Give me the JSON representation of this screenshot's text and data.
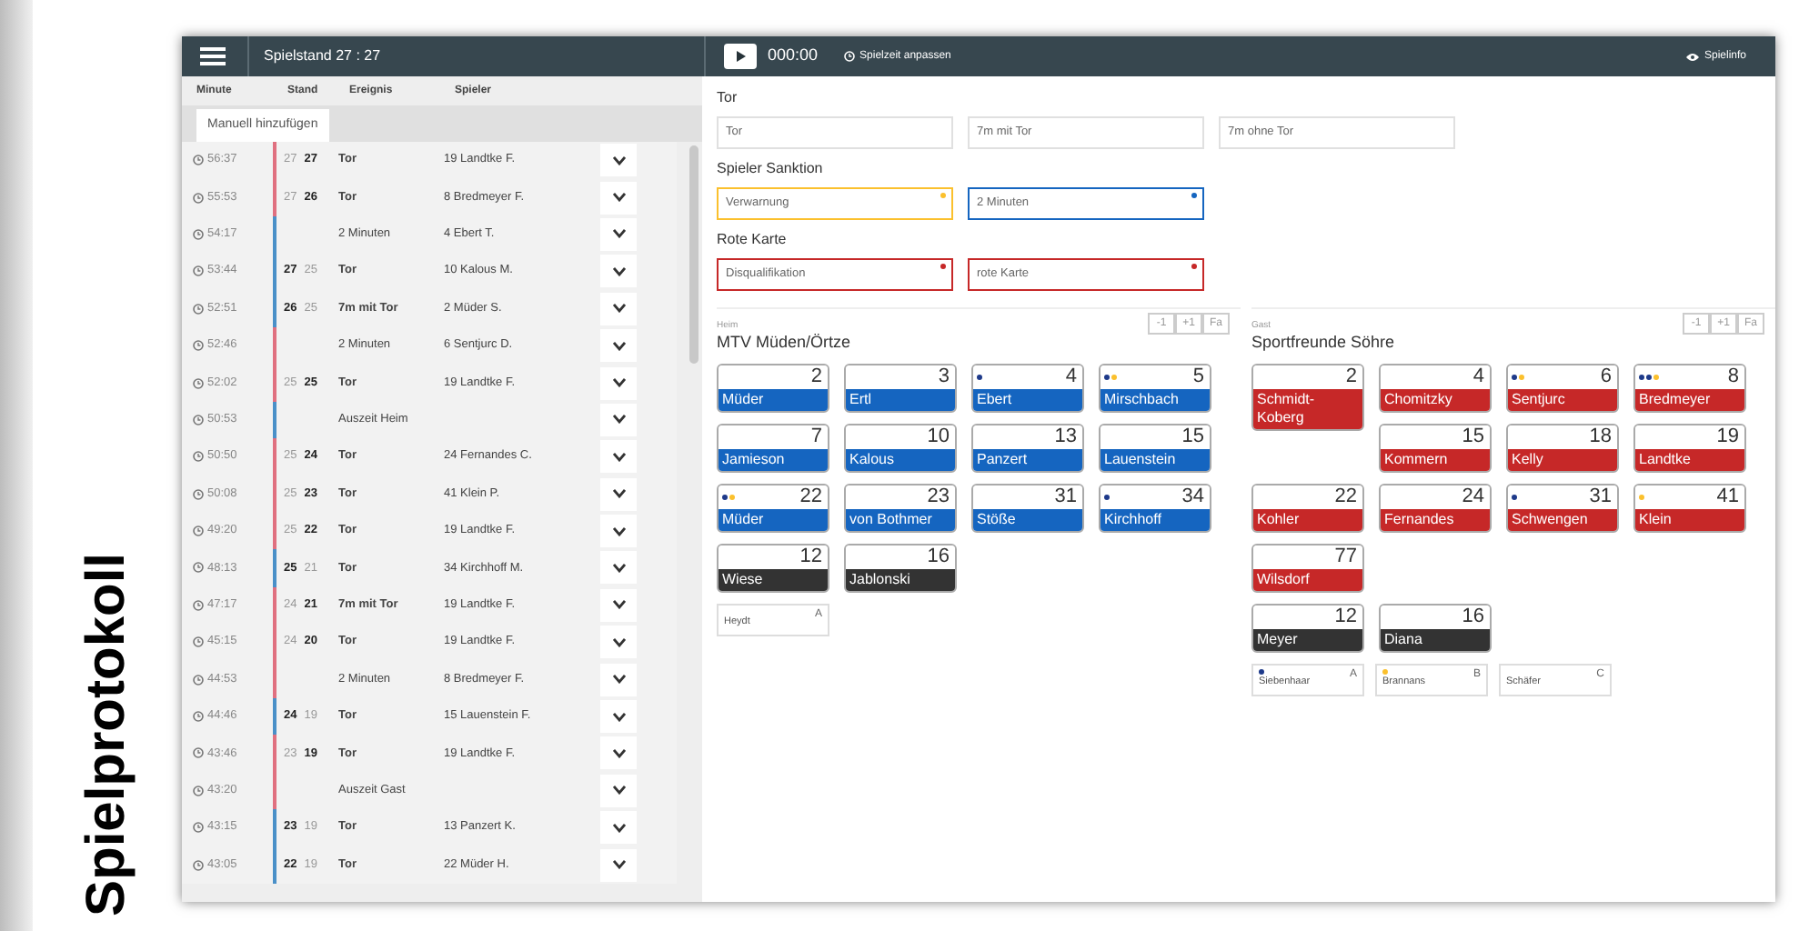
{
  "page_heading": "Spielprotokoll",
  "app": {
    "score_title": "Spielstand 27 : 27",
    "timer": "000:00",
    "adjust_time": "Spielzeit anpassen",
    "info": "Spielinfo"
  },
  "protocol": {
    "columns": [
      "Minute",
      "Stand",
      "Ereignis",
      "Spieler"
    ],
    "add_button": "Manuell hinzufügen",
    "rows": [
      {
        "time": "56:37",
        "color": "#e07080",
        "score": [
          {
            "value": "27",
            "bold": false
          },
          {
            "value": "27",
            "bold": true
          }
        ],
        "event": "Tor",
        "player": "19 Landtke F."
      },
      {
        "time": "55:53",
        "color": "#e07080",
        "score": [
          {
            "value": "27",
            "bold": false
          },
          {
            "value": "26",
            "bold": true
          }
        ],
        "event": "Tor",
        "player": "8 Bredmeyer F."
      },
      {
        "time": "54:17",
        "color": "#4a90c8",
        "event": "2 Minuten",
        "player": "4 Ebert T."
      },
      {
        "time": "53:44",
        "color": "#4a90c8",
        "score": [
          {
            "value": "27",
            "bold": true
          },
          {
            "value": "25",
            "bold": false
          }
        ],
        "event": "Tor",
        "player": "10 Kalous M."
      },
      {
        "time": "52:51",
        "color": "#4a90c8",
        "score": [
          {
            "value": "26",
            "bold": true
          },
          {
            "value": "25",
            "bold": false
          }
        ],
        "event": "7m mit Tor",
        "player": "2 Müder S."
      },
      {
        "time": "52:46",
        "color": "#e07080",
        "event": "2 Minuten",
        "player": "6 Sentjurc D."
      },
      {
        "time": "52:02",
        "color": "#e07080",
        "score": [
          {
            "value": "25",
            "bold": false
          },
          {
            "value": "25",
            "bold": true
          }
        ],
        "event": "Tor",
        "player": "19 Landtke F."
      },
      {
        "time": "50:53",
        "color": "#4a90c8",
        "event": "Auszeit Heim"
      },
      {
        "time": "50:50",
        "color": "#e07080",
        "score": [
          {
            "value": "25",
            "bold": false
          },
          {
            "value": "24",
            "bold": true
          }
        ],
        "event": "Tor",
        "player": "24 Fernandes C."
      },
      {
        "time": "50:08",
        "color": "#e07080",
        "score": [
          {
            "value": "25",
            "bold": false
          },
          {
            "value": "23",
            "bold": true
          }
        ],
        "event": "Tor",
        "player": "41 Klein P."
      },
      {
        "time": "49:20",
        "color": "#e07080",
        "score": [
          {
            "value": "25",
            "bold": false
          },
          {
            "value": "22",
            "bold": true
          }
        ],
        "event": "Tor",
        "player": "19 Landtke F."
      },
      {
        "time": "48:13",
        "color": "#4a90c8",
        "score": [
          {
            "value": "25",
            "bold": true
          },
          {
            "value": "21",
            "bold": false
          }
        ],
        "event": "Tor",
        "player": "34 Kirchhoff M."
      },
      {
        "time": "47:17",
        "color": "#e07080",
        "score": [
          {
            "value": "24",
            "bold": false
          },
          {
            "value": "21",
            "bold": true
          }
        ],
        "event": "7m mit Tor",
        "player": "19 Landtke F."
      },
      {
        "time": "45:15",
        "color": "#e07080",
        "score": [
          {
            "value": "24",
            "bold": false
          },
          {
            "value": "20",
            "bold": true
          }
        ],
        "event": "Tor",
        "player": "19 Landtke F."
      },
      {
        "time": "44:53",
        "color": "#e07080",
        "event": "2 Minuten",
        "player": "8 Bredmeyer F."
      },
      {
        "time": "44:46",
        "color": "#4a90c8",
        "score": [
          {
            "value": "24",
            "bold": true
          },
          {
            "value": "19",
            "bold": false
          }
        ],
        "event": "Tor",
        "player": "15 Lauenstein F."
      },
      {
        "time": "43:46",
        "color": "#e07080",
        "score": [
          {
            "value": "23",
            "bold": false
          },
          {
            "value": "19",
            "bold": true
          }
        ],
        "event": "Tor",
        "player": "19 Landtke F."
      },
      {
        "time": "43:20",
        "color": "#e07080",
        "event": "Auszeit Gast"
      },
      {
        "time": "43:15",
        "color": "#4a90c8",
        "score": [
          {
            "value": "23",
            "bold": true
          },
          {
            "value": "19",
            "bold": false
          }
        ],
        "event": "Tor",
        "player": "13 Panzert K."
      },
      {
        "time": "43:05",
        "color": "#4a90c8",
        "score": [
          {
            "value": "22",
            "bold": true
          },
          {
            "value": "19",
            "bold": false
          }
        ],
        "event": "Tor",
        "player": "22 Müder H."
      }
    ]
  },
  "actions": [
    {
      "title": "Tor",
      "buttons": [
        {
          "label": "Tor"
        },
        {
          "label": "7m mit Tor"
        },
        {
          "label": "7m ohne Tor"
        }
      ]
    },
    {
      "title": "Spieler Sanktion",
      "buttons": [
        {
          "label": "Verwarnung",
          "color": "#fbc02d"
        },
        {
          "label": "2 Minuten",
          "color": "#1565c0"
        }
      ]
    },
    {
      "title": "Rote Karte",
      "buttons": [
        {
          "label": "Disqualifikation",
          "color": "#c62828"
        },
        {
          "label": "rote Karte",
          "color": "#c62828"
        }
      ]
    }
  ],
  "teams": [
    {
      "role": "Heim",
      "name": "MTV Müden/Örtze",
      "color": "#1565c0",
      "controls": [
        "-1",
        "+1",
        "Fa"
      ],
      "players": [
        {
          "number": "2",
          "name": "Müder"
        },
        {
          "number": "3",
          "name": "Ertl"
        },
        {
          "number": "4",
          "name": "Ebert",
          "penalties": [
            {
              "color": "#1e3a8a"
            }
          ]
        },
        {
          "number": "5",
          "name": "Mirschbach",
          "penalties": [
            {
              "color": "#1e3a8a"
            },
            {
              "color": "#fbc02d"
            }
          ]
        },
        {
          "number": "7",
          "name": "Jamieson"
        },
        {
          "number": "10",
          "name": "Kalous"
        },
        {
          "number": "13",
          "name": "Panzert"
        },
        {
          "number": "15",
          "name": "Lauenstein"
        },
        {
          "number": "22",
          "name": "Müder",
          "penalties": [
            {
              "color": "#1e3a8a"
            },
            {
              "color": "#fbc02d"
            }
          ]
        },
        {
          "number": "23",
          "name": "von Bothmer"
        },
        {
          "number": "31",
          "name": "Stöße"
        },
        {
          "number": "34",
          "name": "Kirchhoff",
          "penalties": [
            {
              "color": "#1e3a8a"
            }
          ]
        }
      ],
      "goalkeepers": [
        {
          "number": "12",
          "name": "Wiese"
        },
        {
          "number": "16",
          "name": "Jablonski"
        }
      ],
      "officials": [
        {
          "name": "Heydt",
          "letter": "A"
        }
      ]
    },
    {
      "role": "Gast",
      "name": "Sportfreunde Söhre",
      "color": "#c62828",
      "controls": [
        "-1",
        "+1",
        "Fa"
      ],
      "players": [
        {
          "number": "2",
          "name": "Schmidt-Koberg"
        },
        {
          "number": "4",
          "name": "Chomitzky"
        },
        {
          "number": "6",
          "name": "Sentjurc",
          "penalties": [
            {
              "color": "#1e3a8a"
            },
            {
              "color": "#fbc02d"
            }
          ]
        },
        {
          "number": "8",
          "name": "Bredmeyer",
          "penalties": [
            {
              "color": "#1e3a8a"
            },
            {
              "color": "#1e3a8a"
            },
            {
              "color": "#fbc02d"
            }
          ]
        },
        {
          "number": "15",
          "name": "Kommern"
        },
        {
          "number": "18",
          "name": "Kelly"
        },
        {
          "number": "19",
          "name": "Landtke"
        },
        {
          "number": "22",
          "name": "Kohler"
        },
        {
          "number": "24",
          "name": "Fernandes"
        },
        {
          "number": "31",
          "name": "Schwengen",
          "penalties": [
            {
              "color": "#1e3a8a"
            }
          ]
        },
        {
          "number": "41",
          "name": "Klein",
          "penalties": [
            {
              "color": "#fbc02d"
            }
          ]
        },
        {
          "number": "77",
          "name": "Wilsdorf"
        }
      ],
      "goalkeepers": [
        {
          "number": "12",
          "name": "Meyer"
        },
        {
          "number": "16",
          "name": "Diana"
        }
      ],
      "officials": [
        {
          "name": "Siebenhaar",
          "letter": "A",
          "penalties": [
            {
              "color": "#1e3a8a"
            }
          ]
        },
        {
          "name": "Brannans",
          "letter": "B",
          "penalties": [
            {
              "color": "#fbc02d"
            }
          ]
        },
        {
          "name": "Schäfer",
          "letter": "C"
        }
      ]
    }
  ]
}
